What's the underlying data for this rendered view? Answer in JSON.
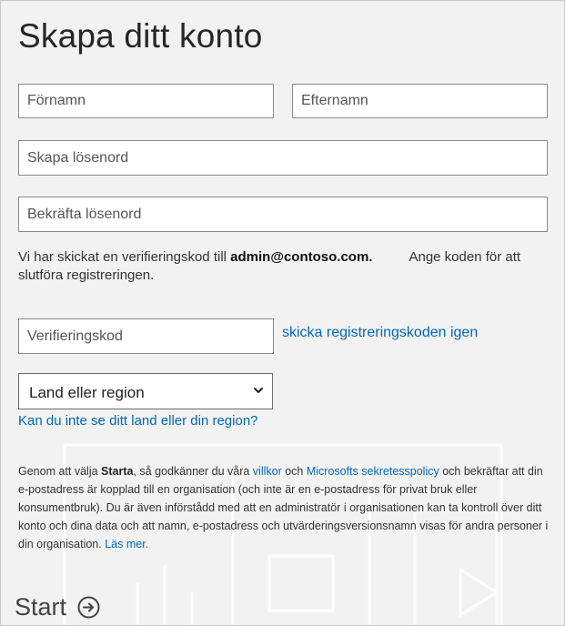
{
  "title": "Skapa ditt konto",
  "form": {
    "first_name_placeholder": "Förnamn",
    "last_name_placeholder": "Efternamn",
    "password_placeholder": "Skapa lösenord",
    "confirm_password_placeholder": "Bekräfta lösenord",
    "verification_code_placeholder": "Verifieringskod"
  },
  "info": {
    "text_before": "Vi har skickat en verifieringskod till ",
    "email": "admin@contoso.com.",
    "text_after": "Ange koden för att slutföra registreringen."
  },
  "resend_link": "skicka registreringskoden igen",
  "region": {
    "selected": "Land eller region",
    "help_link": "Kan du inte se ditt land eller din region?"
  },
  "legal": {
    "part1": "Genom att välja ",
    "start_word": "Starta",
    "part2": ", så godkänner du våra ",
    "terms_link": "villkor",
    "part3": " och ",
    "privacy_link": "Microsofts sekretesspolicy",
    "part4": " och bekräftar att din e-postadress är kopplad till en organisation (och inte är en e-postadress för privat bruk eller konsumentbruk). Du är även införstådd med att en administratör i organisationen kan ta kontroll över ditt konto och dina data och att namn, e-postadress och utvärderingsversionsnamn visas för andra personer i din organisation. ",
    "learn_more_link": "Läs mer."
  },
  "start_button": {
    "label": "Start",
    "icon": "circle-arrow-right-icon"
  },
  "colors": {
    "link": "#0067b8",
    "background": "#f2f2f2",
    "field_border": "#8a8a8a"
  }
}
